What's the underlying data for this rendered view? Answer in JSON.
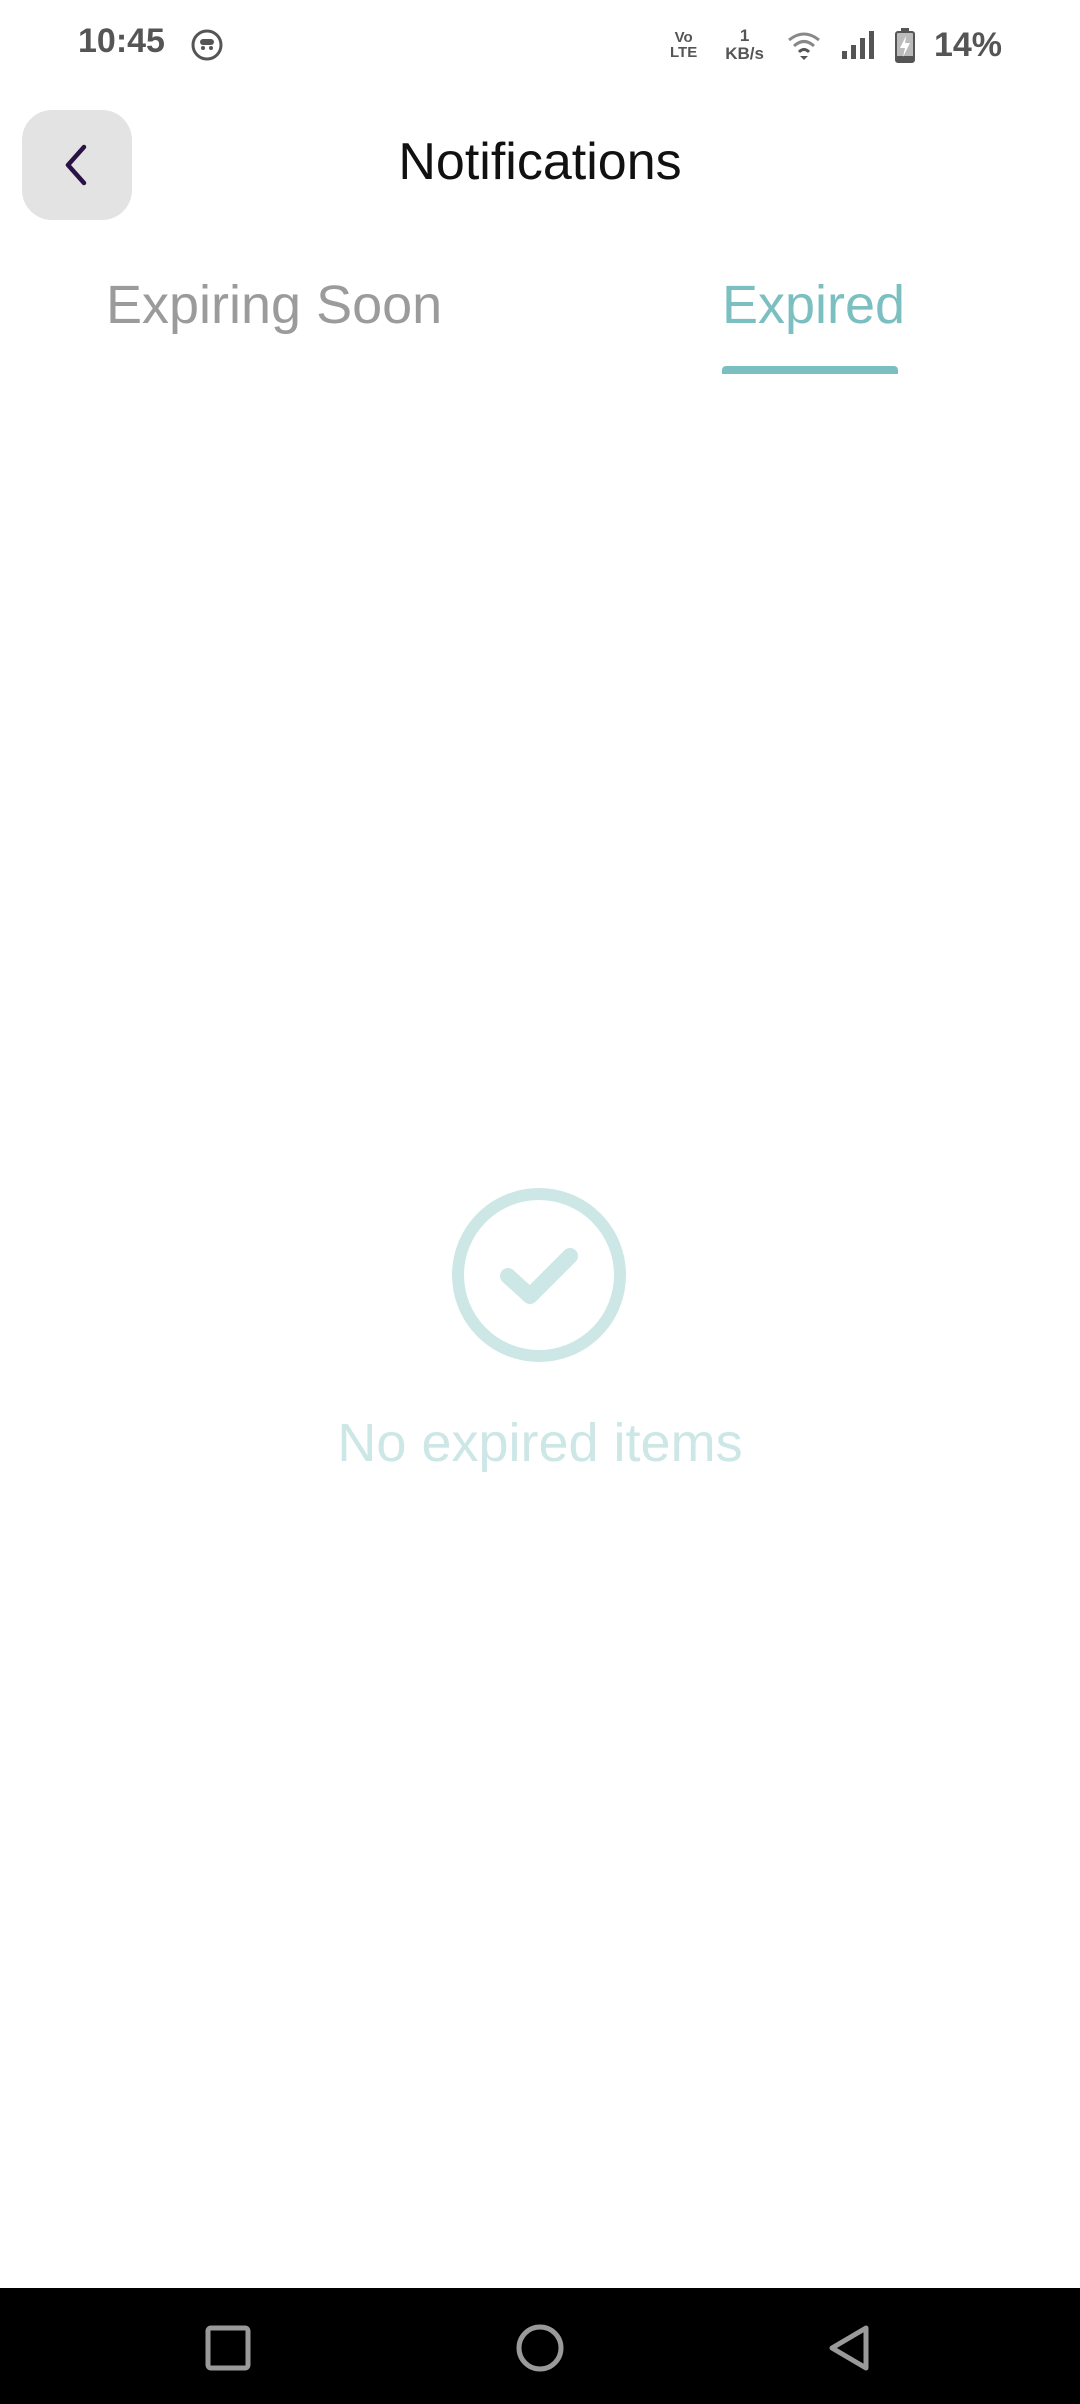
{
  "status_bar": {
    "time": "10:45",
    "volte_top": "Vo",
    "volte_bottom": "LTE",
    "net_speed_value": "1",
    "net_speed_unit": "KB/s",
    "battery_percent": "14%",
    "icons": [
      "app-notification-icon",
      "wifi-icon",
      "signal-icon",
      "battery-charging-icon"
    ]
  },
  "header": {
    "title": "Notifications",
    "back_icon": "chevron-left-icon"
  },
  "tabs": [
    {
      "label": "Expiring Soon",
      "active": false
    },
    {
      "label": "Expired",
      "active": true
    }
  ],
  "empty_state": {
    "icon": "check-circle-icon",
    "message": "No expired items"
  },
  "colors": {
    "accent": "#7bbfc1",
    "inactive_tab": "#9b9b9b",
    "empty_tint": "#cde6e6",
    "back_button_bg": "#e3e3e3",
    "back_chevron": "#2a1245"
  },
  "nav_bar": {
    "buttons": [
      "recents-button",
      "home-button",
      "back-button"
    ]
  }
}
